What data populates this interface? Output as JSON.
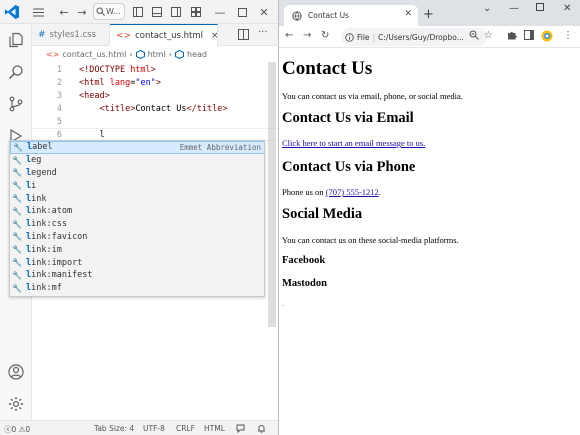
{
  "vscode": {
    "titlebar": {
      "search_text": "W..."
    },
    "tabs": [
      {
        "label": "styles1.css",
        "icon": "css-file-icon",
        "active": false
      },
      {
        "label": "contact_us.html",
        "icon": "html-file-icon",
        "active": true,
        "close": "×"
      }
    ],
    "breadcrumb": {
      "file": "contact_us.html",
      "items": [
        "html",
        "head"
      ],
      "sep": "›"
    },
    "editor": {
      "lines": [
        {
          "num": "1",
          "parts": [
            [
              "tag",
              "<!DOCTYPE "
            ],
            [
              "attr",
              "html"
            ],
            [
              "tag",
              ">"
            ]
          ]
        },
        {
          "num": "2",
          "parts": [
            [
              "tag",
              "<html "
            ],
            [
              "attr",
              "lang"
            ],
            [
              "txt",
              "="
            ],
            [
              "str",
              "\"en\""
            ],
            [
              "tag",
              ">"
            ]
          ]
        },
        {
          "num": "3",
          "parts": [
            [
              "tag",
              "<head>"
            ]
          ]
        },
        {
          "num": "4",
          "parts": [
            [
              "txt",
              "    "
            ],
            [
              "tag",
              "<title>"
            ],
            [
              "txt",
              "Contact Us"
            ],
            [
              "tag",
              "</title>"
            ]
          ]
        },
        {
          "num": "5",
          "parts": []
        },
        {
          "num": "6",
          "parts": [
            [
              "txt",
              "    l"
            ]
          ]
        }
      ]
    },
    "suggest": {
      "detail": "Emmet Abbreviation",
      "items": [
        {
          "match": "l",
          "rest": "abel",
          "selected": true
        },
        {
          "match": "l",
          "rest": "eg"
        },
        {
          "match": "l",
          "rest": "egend"
        },
        {
          "match": "l",
          "rest": "i"
        },
        {
          "match": "l",
          "rest": "ink"
        },
        {
          "match": "l",
          "rest": "ink:atom"
        },
        {
          "match": "l",
          "rest": "ink:css"
        },
        {
          "match": "l",
          "rest": "ink:favicon"
        },
        {
          "match": "l",
          "rest": "ink:im"
        },
        {
          "match": "l",
          "rest": "ink:import"
        },
        {
          "match": "l",
          "rest": "ink:manifest"
        },
        {
          "match": "l",
          "rest": "ink:mf"
        }
      ]
    },
    "status": {
      "errors": "0",
      "warnings": "0",
      "tab_size": "Tab Size: 4",
      "encoding": "UTF-8",
      "eol": "CRLF",
      "language": "HTML"
    }
  },
  "browser": {
    "tab_title": "Contact Us",
    "new_tab": "+",
    "omnibox": {
      "scheme_label": "File",
      "url": "C:/Users/Guy/Dropbo..."
    },
    "page": {
      "h1": "Contact Us",
      "intro": "You can contact us via email, phone, or social media.",
      "email_heading": "Contact Us via Email",
      "email_link": "Click here to start an email message to us.",
      "phone_heading": "Contact Us via Phone",
      "phone_prefix": "Phone us on ",
      "phone_number": "(707) 555-1212",
      "phone_suffix": ".",
      "social_heading": "Social Media",
      "social_text": "You can contact us on these social-media platforms.",
      "facebook": "Facebook",
      "mastodon": "Mastodon",
      "trailing_dot": "."
    }
  },
  "colors": {
    "vscode_accent": "#0066b8",
    "html_tag": "#800000",
    "html_attr": "#e50000",
    "html_string": "#0000ff",
    "link": "#1a0dab"
  }
}
